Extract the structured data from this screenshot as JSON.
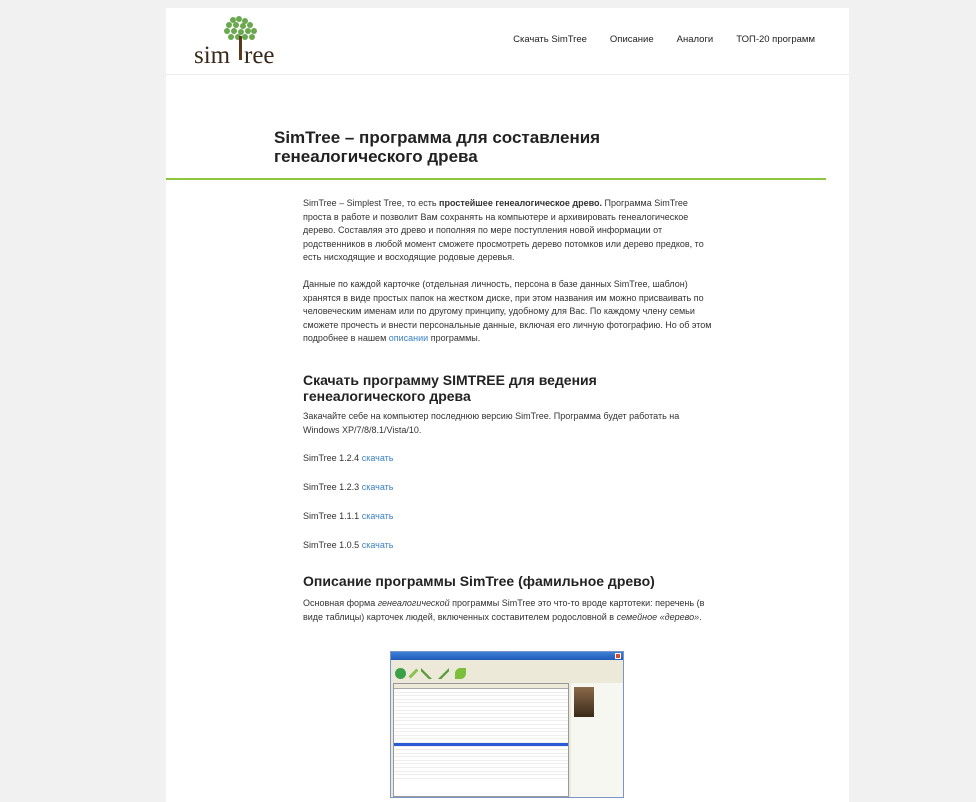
{
  "brand": {
    "name": "simtree",
    "color": "#5a8a2a",
    "accent": "#8dc63f"
  },
  "nav": [
    {
      "label": "Скачать SimTree"
    },
    {
      "label": "Описание"
    },
    {
      "label": "Аналоги"
    },
    {
      "label": "ТОП-20 программ"
    }
  ],
  "page_title": "SimTree – программа для составления генеалогического древа",
  "intro": {
    "p1_before": "SimTree – Simplest Tree, то есть ",
    "p1_bold": "простейшее генеалогическое древо.",
    "p1_after": " Программа SimTree проста в работе и позволит Вам сохранять на компьютере и архивировать генеалогическое дерево. Составляя это древо и пополняя по мере поступления новой информации от родственников в любой момент сможете просмотреть дерево потомков или дерево предков, то есть нисходящие и восходящие родовые деревья.",
    "p2_before": "Данные по каждой карточке (отдельная личность, персона в базе данных SimTree, шаблон) хранятся в виде простых папок на жестком диске, при этом названия им можно присваивать по человеческим именам или по другому принципу, удобному для Вас. По каждому члену семьи сможете прочесть и внести персональные данные, включая его личную фотографию. Но об этом подробнее в нашем ",
    "p2_link": "описании",
    "p2_after": " программы."
  },
  "download": {
    "heading": "Скачать программу SIMTREE для ведения генеалогического древа",
    "text": "Закачайте себе на компьютер последнюю версию SimTree. Программа будет работать на Windows XP/7/8/8.1/Vista/10.",
    "versions": [
      {
        "name": "SimTree 1.2.4",
        "link": "скачать"
      },
      {
        "name": "SimTree 1.2.3",
        "link": "скачать"
      },
      {
        "name": "SimTree 1.1.1",
        "link": "скачать"
      },
      {
        "name": "SimTree 1.0.5",
        "link": "скачать"
      }
    ]
  },
  "description": {
    "heading": "Описание программы SimTree (фамильное древо)",
    "t1": "Основная форма ",
    "t1_em": "генеалогической",
    "t2": " программы SimTree это что-то вроде картотеки: перечень (в виде таблицы) карточек людей, включенных составителем родословной в ",
    "t2_em": "семейное «дерево»",
    "t3": "."
  }
}
